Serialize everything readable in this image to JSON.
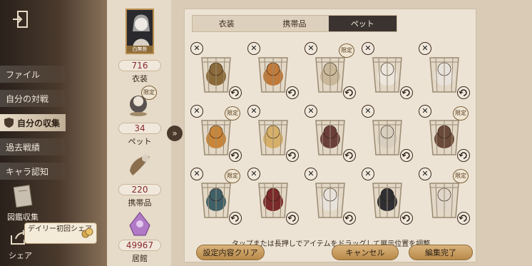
{
  "sidebar": {
    "items": [
      {
        "label": "ファイル"
      },
      {
        "label": "自分の対戦"
      },
      {
        "label": "自分の収集"
      },
      {
        "label": "過去戦績"
      },
      {
        "label": "キャラ認知"
      }
    ],
    "book_label": "図鑑収集",
    "share_label": "シェア",
    "daily_share_label": "デイリー初回シェア"
  },
  "stats": {
    "portrait_name": "白無咎",
    "costume": {
      "value": "716",
      "label": "衣装"
    },
    "pet": {
      "value": "34",
      "label": "ペット"
    },
    "accessory": {
      "value": "220",
      "label": "携帯品"
    },
    "house": {
      "value": "49967",
      "label": "居館"
    },
    "limited_badge": "限定"
  },
  "tabs": [
    {
      "label": "衣装"
    },
    {
      "label": "携帯品"
    },
    {
      "label": "ペット"
    }
  ],
  "grid": {
    "slots": [
      {
        "limited": false,
        "remove": "✕"
      },
      {
        "limited": false,
        "remove": "✕"
      },
      {
        "limited": true,
        "remove": "✕"
      },
      {
        "limited": false,
        "remove": "✕"
      },
      {
        "limited": false,
        "remove": "✕"
      },
      {
        "limited": true,
        "remove": "✕"
      },
      {
        "limited": false,
        "remove": "✕"
      },
      {
        "limited": false,
        "remove": "✕"
      },
      {
        "limited": false,
        "remove": "✕"
      },
      {
        "limited": true,
        "remove": "✕"
      },
      {
        "limited": true,
        "remove": "✕"
      },
      {
        "limited": false,
        "remove": "✕"
      },
      {
        "limited": false,
        "remove": "✕"
      },
      {
        "limited": false,
        "remove": "✕"
      },
      {
        "limited": true,
        "remove": "✕"
      }
    ],
    "limited_label": "限定"
  },
  "hint": "タップまたは長押しでアイテムをドラッグして展示位置を調整",
  "buttons": {
    "clear": "設定内容クリア",
    "cancel": "キャンセル",
    "done": "編集完了"
  },
  "colors": {
    "accent": "#b88a4a",
    "active_tab": "#3a3330",
    "value_red": "#8a2b2b"
  }
}
